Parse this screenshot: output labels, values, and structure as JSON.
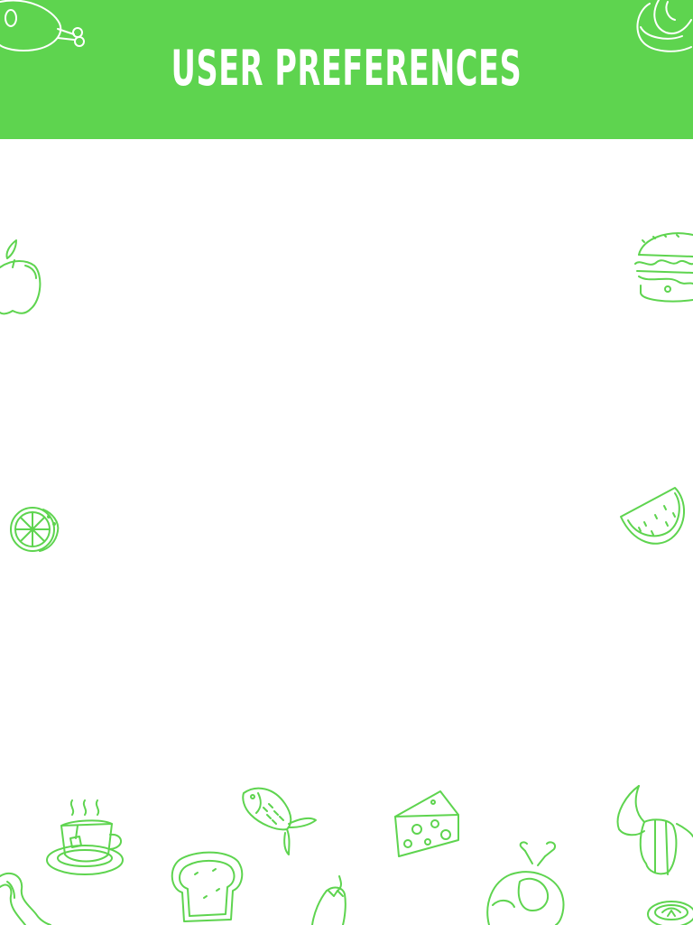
{
  "header": {
    "title": "USER PREFERENCES",
    "background_color": "#5ed44f",
    "title_color": "#ffffff"
  },
  "decor": {
    "line_color": "#5ed44f",
    "icons": [
      "ham-leg-icon",
      "pretzel-icon",
      "apple-icon",
      "burger-icon",
      "lemon-slice-icon",
      "watermelon-slice-icon",
      "tea-cup-icon",
      "fish-icon",
      "cheese-icon",
      "croissant-icon",
      "toast-icon",
      "eggplant-icon",
      "roast-chicken-icon",
      "bacon-icon",
      "sushi-roll-icon"
    ]
  }
}
